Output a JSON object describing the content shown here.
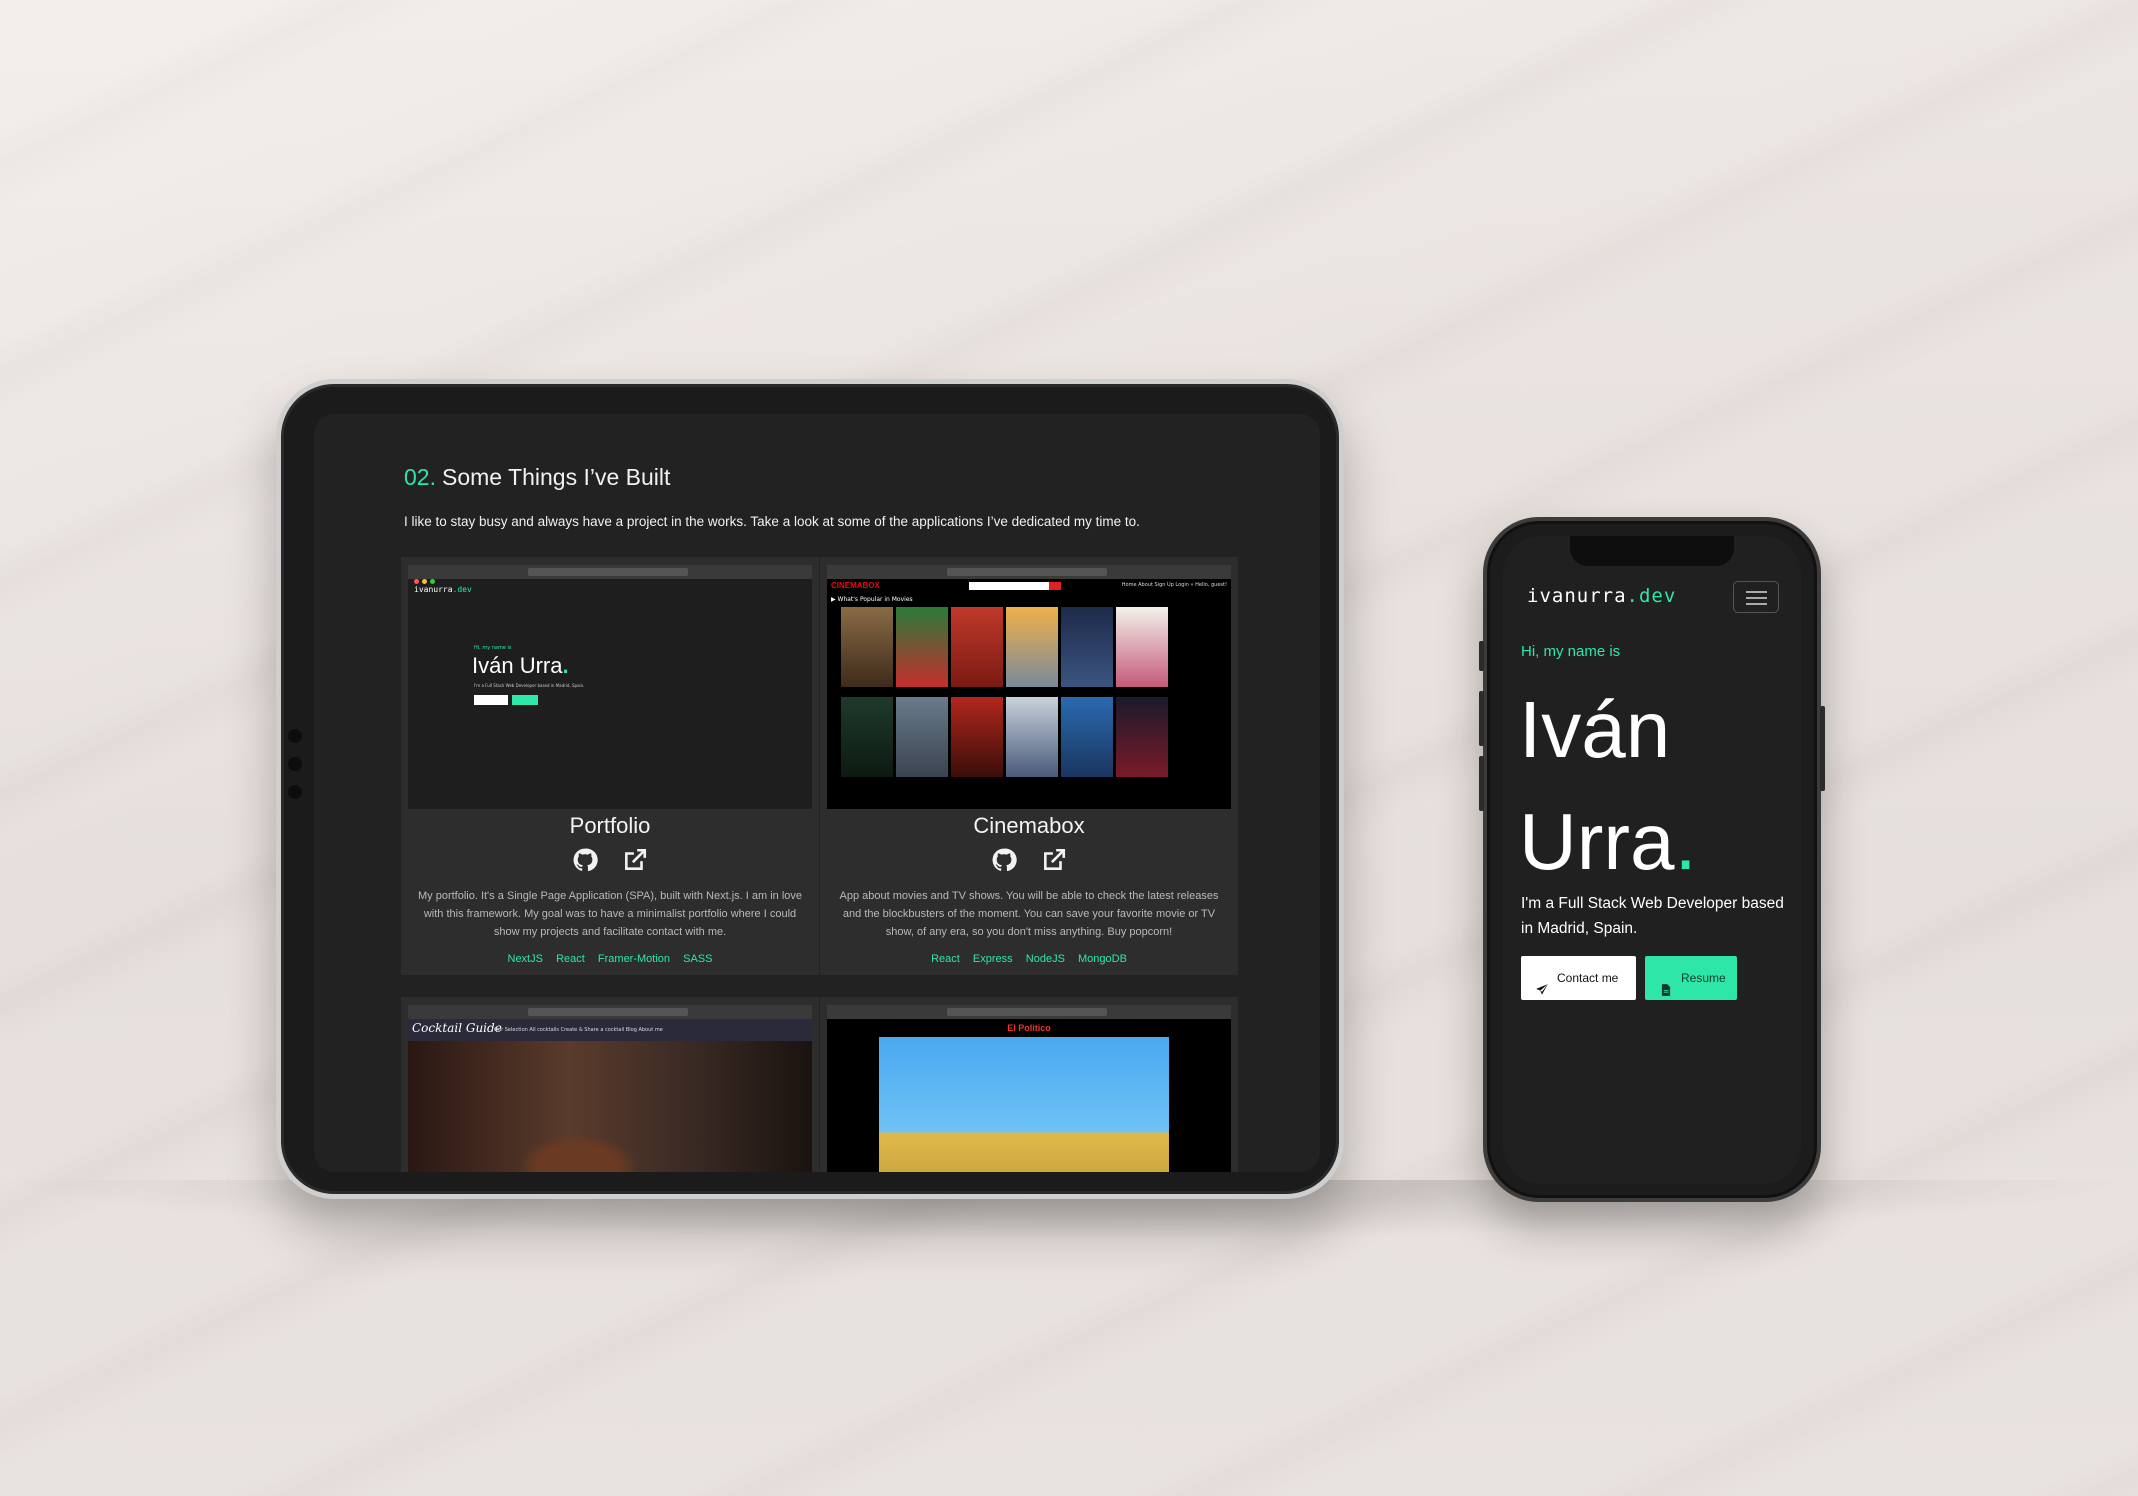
{
  "colors": {
    "accent": "#2ee6a8",
    "background": "#222222",
    "card": "#2d2d2d"
  },
  "tablet": {
    "section_number": "02.",
    "section_title": "Some Things I’ve Built",
    "section_description": "I like to stay busy and always have a project in the works. Take a look at some of the applications I’ve dedicated my time to.",
    "projects": [
      {
        "title": "Portfolio",
        "description": "My portfolio. It's a Single Page Application (SPA), built with Next.js. I am in love with this framework. My goal was to have a minimalist portfolio where I could show my projects and facilitate contact with me.",
        "tags": [
          "NextJS",
          "React",
          "Framer-Motion",
          "SASS"
        ],
        "icons": [
          "github-icon",
          "external-link-icon"
        ],
        "shot": {
          "logo_main": "ivanurra",
          "logo_tld": ".dev",
          "hi": "Hi, my name is",
          "name": "Iván Urra",
          "sub": "I'm a Full Stack Web Developer based in Madrid, Spain."
        }
      },
      {
        "title": "Cinemabox",
        "description": "App about movies and TV shows. You will be able to check the latest releases and the blockbusters of the moment. You can save your favorite movie or TV show, of any era, so you don't miss anything. Buy popcorn!",
        "tags": [
          "React",
          "Express",
          "NodeJS",
          "MongoDB"
        ],
        "icons": [
          "github-icon",
          "external-link-icon"
        ],
        "shot": {
          "logo": "CINEMABOX",
          "links": "Home  About  Sign Up  Login  » Hello, guest!",
          "popular": "▶ What's Popular in Movies"
        }
      },
      {
        "title": "",
        "shot": {
          "logo": "Cocktail Guide",
          "links": "Our Selection   All cocktails   Create & Share a cocktail   Blog   About me"
        }
      },
      {
        "title": "",
        "shot": {
          "logo": "El Politico"
        }
      }
    ]
  },
  "phone": {
    "logo_main": "ivanurra",
    "logo_tld": ".dev",
    "greeting": "Hi, my name is",
    "name_line1": "Iván",
    "name_line2": "Urra",
    "name_dot": ".",
    "subtitle": "I'm a Full Stack Web Developer based in Madrid, Spain.",
    "contact_label": "Contact me",
    "resume_label": "Resume"
  }
}
